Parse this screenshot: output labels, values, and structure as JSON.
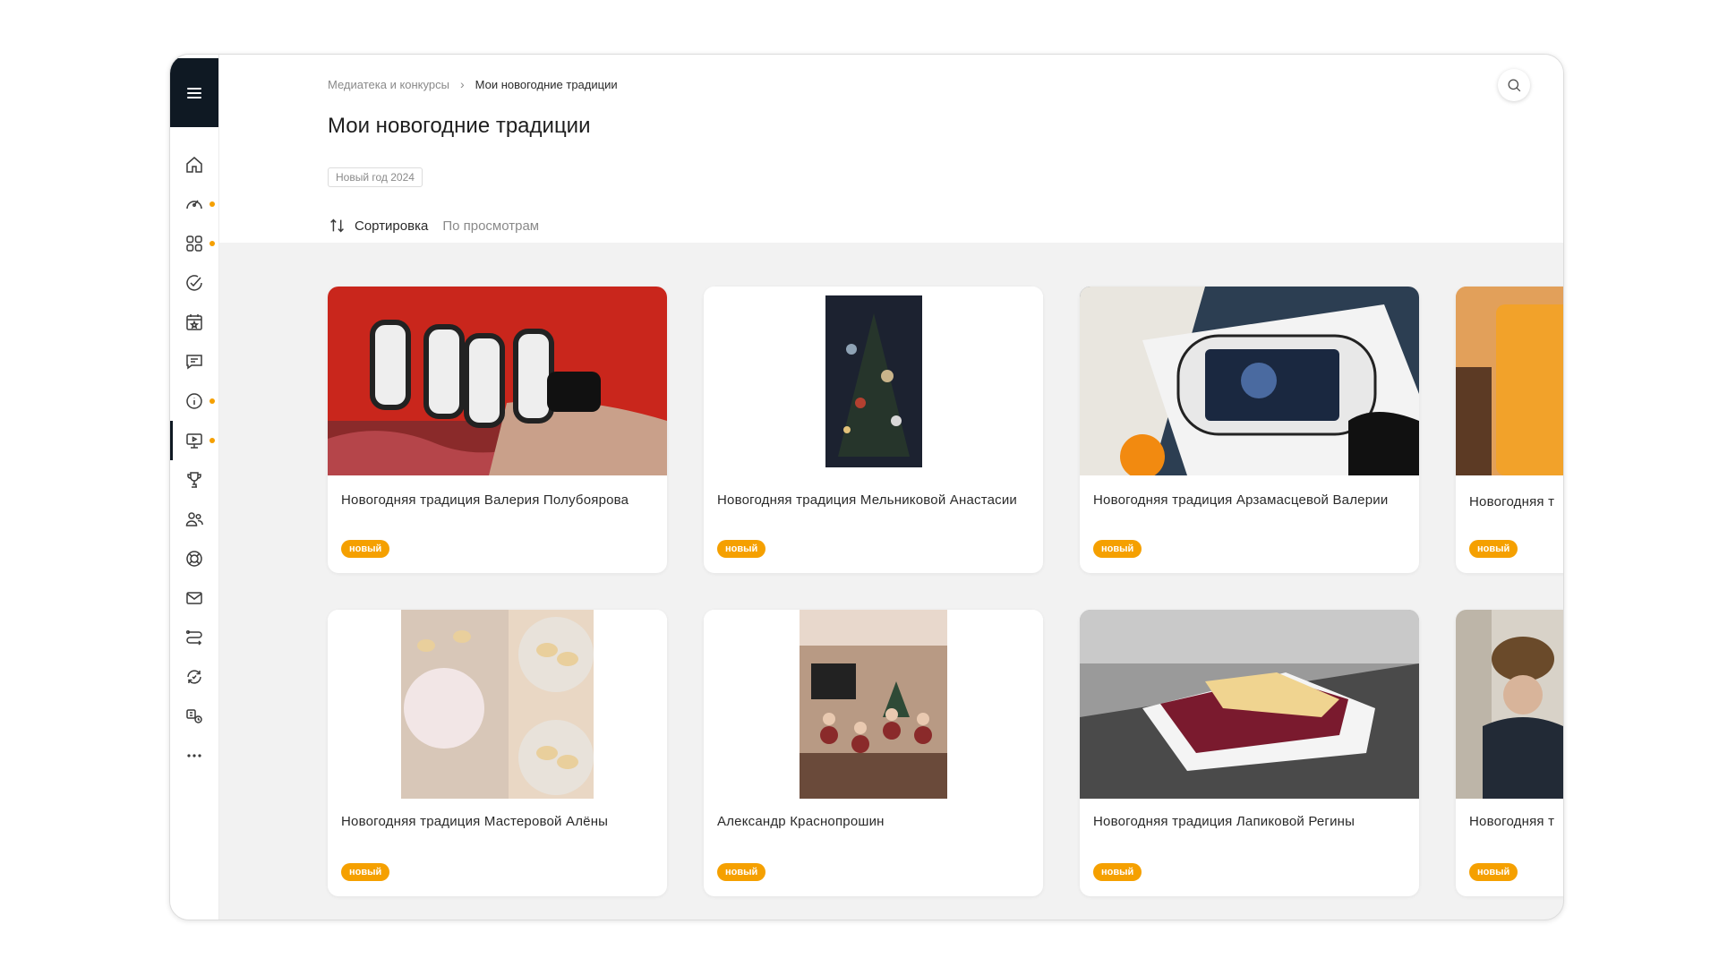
{
  "breadcrumb": {
    "parent": "Медиатека и конкурсы",
    "separator": "›",
    "current": "Мои новогодние традиции"
  },
  "page": {
    "title": "Мои новогодние традиции",
    "tag": "Новый год 2024"
  },
  "sort": {
    "label": "Сортировка",
    "value": "По просмотрам"
  },
  "sidebar": {
    "items": [
      {
        "icon": "home-icon",
        "dot": false
      },
      {
        "icon": "speedometer-icon",
        "dot": true
      },
      {
        "icon": "apps-grid-icon",
        "dot": true
      },
      {
        "icon": "check-circle-icon",
        "dot": false
      },
      {
        "icon": "calendar-star-icon",
        "dot": false
      },
      {
        "icon": "chat-icon",
        "dot": false
      },
      {
        "icon": "info-icon",
        "dot": true
      },
      {
        "icon": "media-screen-icon",
        "dot": true,
        "active": true
      },
      {
        "icon": "trophy-icon",
        "dot": false
      },
      {
        "icon": "people-icon",
        "dot": false
      },
      {
        "icon": "lifebuoy-icon",
        "dot": false
      },
      {
        "icon": "mail-icon",
        "dot": false
      },
      {
        "icon": "route-icon",
        "dot": false
      },
      {
        "icon": "sync-icon",
        "dot": false
      },
      {
        "icon": "services-icon",
        "dot": false
      },
      {
        "icon": "more-icon",
        "dot": false
      }
    ]
  },
  "cards": [
    {
      "title": "Новогодняя традиция Валерия Полубоярова",
      "badge": "новый"
    },
    {
      "title": "Новогодняя традиция Мельниковой Анастасии",
      "badge": "новый"
    },
    {
      "title": "Новогодняя традиция Арзамасцевой Валерии",
      "badge": "новый"
    },
    {
      "title": "Новогодняя т",
      "badge": "новый"
    },
    {
      "title": "Новогодняя традиция Мастеровой Алёны",
      "badge": "новый"
    },
    {
      "title": "Александр Краснопрошин",
      "badge": "новый"
    },
    {
      "title": "Новогодняя традиция Лапиковой Регины",
      "badge": "новый"
    },
    {
      "title": "Новогодняя т",
      "badge": "новый"
    }
  ],
  "colors": {
    "accent": "#f5a000",
    "sidebar_dark": "#0f1923",
    "background": "#f2f2f2"
  }
}
